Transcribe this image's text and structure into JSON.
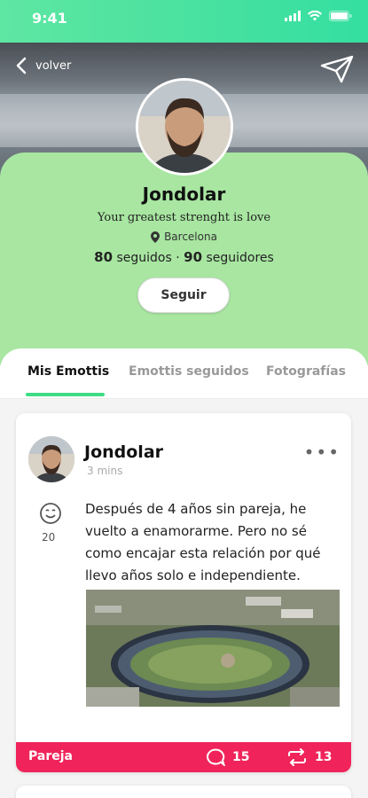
{
  "status_bar": {
    "time": "9:41"
  },
  "header": {
    "back_label": "volver"
  },
  "profile": {
    "name": "Jondolar",
    "bio": "Your greatest strenght is love",
    "location": "Barcelona",
    "following_count": "80",
    "following_label": "seguidos",
    "separator": "·",
    "followers_count": "90",
    "followers_label": "seguidores",
    "follow_button": "Seguir"
  },
  "tabs": [
    {
      "label": "Mis Emottis",
      "active": true
    },
    {
      "label": "Emottis seguidos",
      "active": false
    },
    {
      "label": "Fotografías",
      "active": false
    }
  ],
  "post": {
    "author": "Jondolar",
    "time_ago": "3 mins",
    "reaction_count": "20",
    "text": "Después de 4 años sin pareja, he vuelto a enamorarme. Pero no sé como encajar esta relación por qué llevo años solo e independiente.",
    "category": "Pareja",
    "comments": "15",
    "reposts": "13"
  },
  "colors": {
    "accent_green": "#3ddc84",
    "profile_bg": "#a8e6a1",
    "category_bar": "#f0245a"
  },
  "icons": [
    "back-chevron-icon",
    "send-icon",
    "location-pin-icon",
    "more-icon",
    "emoji-icon",
    "comment-icon",
    "repost-icon"
  ]
}
